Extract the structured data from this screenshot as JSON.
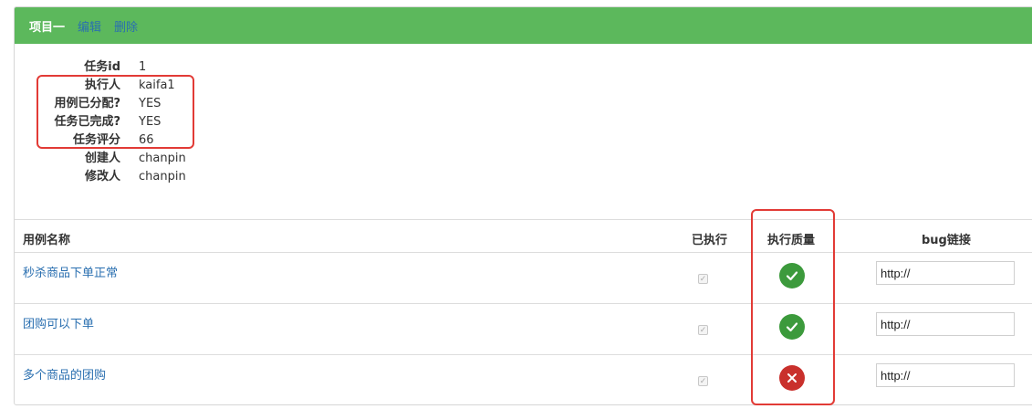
{
  "header": {
    "title": "项目一",
    "edit_label": "编辑",
    "delete_label": "删除",
    "color": "#5cb85c"
  },
  "info": [
    {
      "label": "任务id",
      "value": "1"
    },
    {
      "label": "执行人",
      "value": "kaifa1"
    },
    {
      "label": "用例已分配?",
      "value": "YES"
    },
    {
      "label": "任务已完成?",
      "value": "YES"
    },
    {
      "label": "任务评分",
      "value": "66"
    },
    {
      "label": "创建人",
      "value": "chanpin"
    },
    {
      "label": "修改人",
      "value": "chanpin"
    }
  ],
  "table": {
    "columns": [
      "用例名称",
      "已执行",
      "执行质量",
      "bug链接"
    ],
    "rows": [
      {
        "name": "秒杀商品下单正常",
        "executed": true,
        "quality": "pass",
        "quality_icon": "check-circle-icon",
        "bug_link": "http://"
      },
      {
        "name": "团购可以下单",
        "executed": true,
        "quality": "pass",
        "quality_icon": "check-circle-icon",
        "bug_link": "http://"
      },
      {
        "name": "多个商品的团购",
        "executed": true,
        "quality": "fail",
        "quality_icon": "x-circle-icon",
        "bug_link": "http://"
      }
    ]
  },
  "colors": {
    "pass": "#3c9a3c",
    "fail": "#c9302c",
    "link": "#2a6fb0",
    "highlight_box": "#e23b36"
  }
}
